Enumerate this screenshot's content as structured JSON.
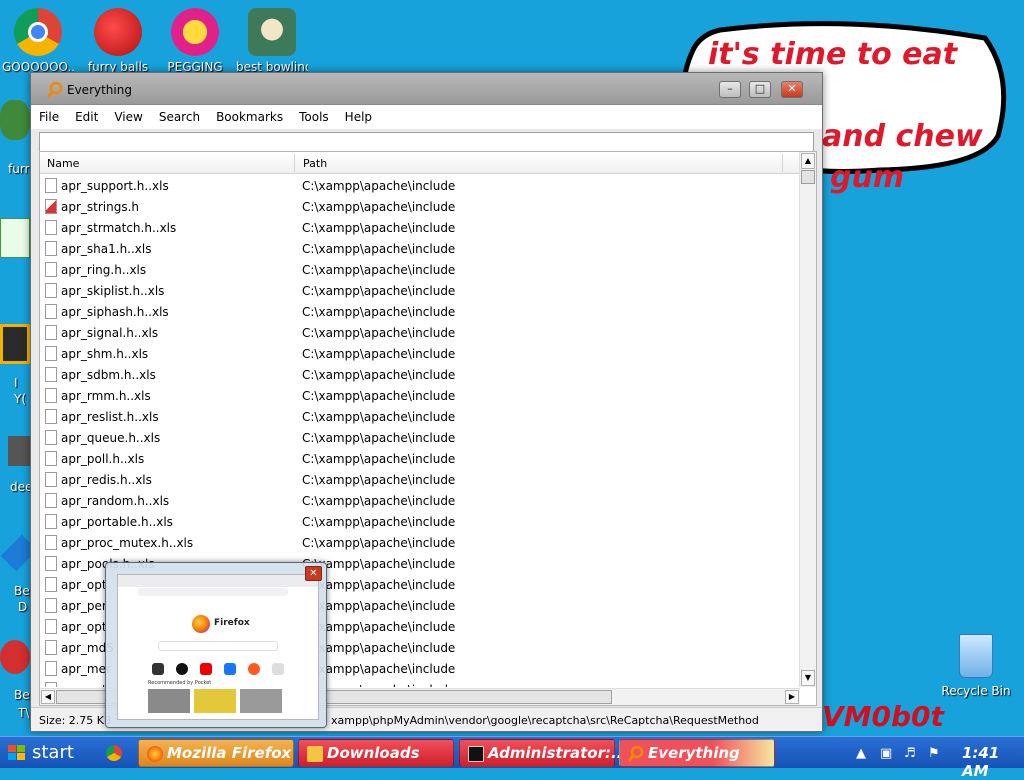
{
  "desktop": {
    "icons": [
      {
        "label": "GOOOOOO...",
        "name": "chrome"
      },
      {
        "label": "furry balls",
        "name": "furry-balls"
      },
      {
        "label": "PEGGING",
        "name": "pegging"
      },
      {
        "label": "best bowling",
        "name": "best-bowling"
      }
    ],
    "left_labels": [
      "furr",
      "I",
      "Y(",
      "dee",
      "Be",
      "D",
      "Be",
      "T\\"
    ],
    "recycle_bin": "Recycle Bin",
    "bubble": {
      "line1": "it's time to eat shit",
      "line2": "and chew",
      "line3": "gum"
    },
    "tag": "VM0b0t"
  },
  "window": {
    "title": "Everything",
    "menu": [
      "File",
      "Edit",
      "View",
      "Search",
      "Bookmarks",
      "Tools",
      "Help"
    ],
    "search_value": "",
    "columns": {
      "name": "Name",
      "path": "Path"
    },
    "rows": [
      {
        "name": "apr_support.h..xls",
        "path": "C:\\xampp\\apache\\include",
        "icon": "doc"
      },
      {
        "name": "apr_strings.h",
        "path": "C:\\xampp\\apache\\include",
        "icon": "h-file"
      },
      {
        "name": "apr_strmatch.h..xls",
        "path": "C:\\xampp\\apache\\include",
        "icon": "doc"
      },
      {
        "name": "apr_sha1.h..xls",
        "path": "C:\\xampp\\apache\\include",
        "icon": "doc"
      },
      {
        "name": "apr_ring.h..xls",
        "path": "C:\\xampp\\apache\\include",
        "icon": "doc"
      },
      {
        "name": "apr_skiplist.h..xls",
        "path": "C:\\xampp\\apache\\include",
        "icon": "doc"
      },
      {
        "name": "apr_siphash.h..xls",
        "path": "C:\\xampp\\apache\\include",
        "icon": "doc"
      },
      {
        "name": "apr_signal.h..xls",
        "path": "C:\\xampp\\apache\\include",
        "icon": "doc"
      },
      {
        "name": "apr_shm.h..xls",
        "path": "C:\\xampp\\apache\\include",
        "icon": "doc"
      },
      {
        "name": "apr_sdbm.h..xls",
        "path": "C:\\xampp\\apache\\include",
        "icon": "doc"
      },
      {
        "name": "apr_rmm.h..xls",
        "path": "C:\\xampp\\apache\\include",
        "icon": "doc"
      },
      {
        "name": "apr_reslist.h..xls",
        "path": "C:\\xampp\\apache\\include",
        "icon": "doc"
      },
      {
        "name": "apr_queue.h..xls",
        "path": "C:\\xampp\\apache\\include",
        "icon": "doc"
      },
      {
        "name": "apr_poll.h..xls",
        "path": "C:\\xampp\\apache\\include",
        "icon": "doc"
      },
      {
        "name": "apr_redis.h..xls",
        "path": "C:\\xampp\\apache\\include",
        "icon": "doc"
      },
      {
        "name": "apr_random.h..xls",
        "path": "C:\\xampp\\apache\\include",
        "icon": "doc"
      },
      {
        "name": "apr_portable.h..xls",
        "path": "C:\\xampp\\apache\\include",
        "icon": "doc"
      },
      {
        "name": "apr_proc_mutex.h..xls",
        "path": "C:\\xampp\\apache\\include",
        "icon": "doc"
      },
      {
        "name": "apr_pools.h..xls",
        "path": "C:\\xampp\\apache\\include",
        "icon": "doc"
      },
      {
        "name": "apr_opt",
        "path": "C:\\xampp\\apache\\include",
        "icon": "doc"
      },
      {
        "name": "apr_per",
        "path": "C:\\xampp\\apache\\include",
        "icon": "doc"
      },
      {
        "name": "apr_opt",
        "path": "C:\\xampp\\apache\\include",
        "icon": "doc"
      },
      {
        "name": "apr_md5",
        "path": "C:\\xampp\\apache\\include",
        "icon": "doc"
      },
      {
        "name": "apr_mer",
        "path": "C:\\xampp\\apache\\include",
        "icon": "doc"
      },
      {
        "name": "apr_net",
        "path": "C:\\xampp\\apache\\include",
        "icon": "doc"
      }
    ],
    "status": {
      "size": "Size: 2.75 KB",
      "path": "xampp\\phpMyAdmin\\vendor\\google\\recaptcha\\src\\ReCaptcha\\RequestMethod"
    }
  },
  "preview": {
    "app_text": "Firefox",
    "section": "Recommended by Pocket"
  },
  "taskbar": {
    "start": "start",
    "tasks": [
      {
        "label": "Mozilla Firefox",
        "color": "#e8902a"
      },
      {
        "label": "Downloads",
        "color": "#e0303a"
      },
      {
        "label": "Administrator:...",
        "color": "#e0303a"
      },
      {
        "label": "Everything",
        "color": "#e0303a"
      }
    ],
    "clock": "1:41 AM"
  },
  "colors": {
    "desktop": "#17a2dc",
    "bubble_text": "#e0182b",
    "taskbar": "#1f5fc7"
  }
}
